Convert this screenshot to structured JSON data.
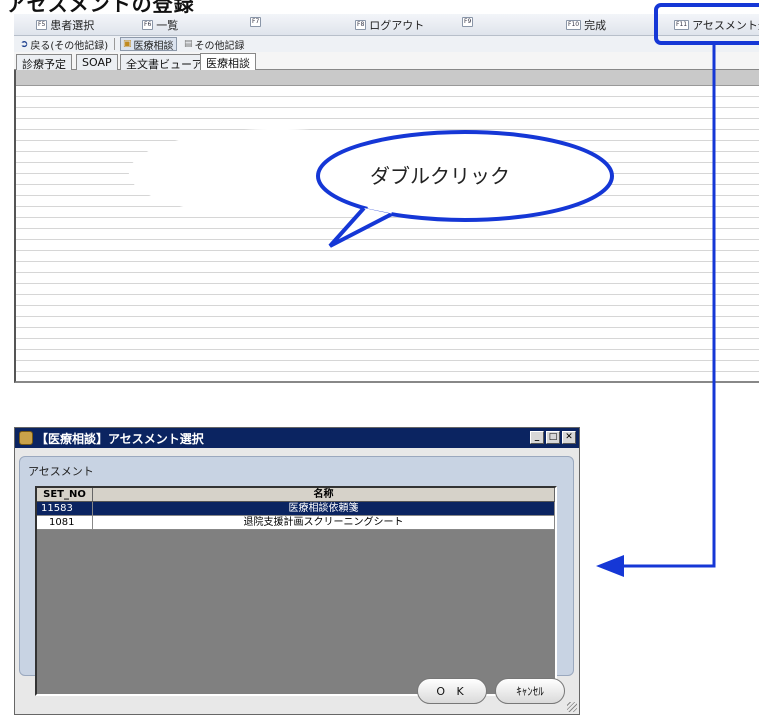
{
  "heading": "アセスメントの登録",
  "fkeys": [
    {
      "key": "F5",
      "label": "患者選択"
    },
    {
      "key": "F6",
      "label": "一覧"
    },
    {
      "key": "F7",
      "label": ""
    },
    {
      "key": "F8",
      "label": "ログアウト"
    },
    {
      "key": "F9",
      "label": ""
    },
    {
      "key": "F10",
      "label": "完成"
    },
    {
      "key": "F11",
      "label": "アセスメント登録"
    }
  ],
  "subbar": {
    "back": "戻る(その他記録)",
    "consult": "医療相談",
    "other": "その他記録"
  },
  "tabs": [
    "診療予定",
    "SOAP",
    "全文書ビューア",
    "医療相談"
  ],
  "callout": "ダブルクリック",
  "dialog": {
    "title": "【医療相談】アセスメント選択",
    "group_label": "アセスメント",
    "columns": [
      "SET_NO",
      "名称"
    ],
    "rows": [
      {
        "set_no": "11583",
        "name": "医療相談依頼箋"
      },
      {
        "set_no": "1081",
        "name": "退院支援計画スクリーニングシート"
      }
    ],
    "ok_label": "O K",
    "cancel_label": "ｷｬﾝｾﾙ"
  },
  "colors": {
    "highlight": "#1537d6",
    "title_bar": "#0b2461"
  }
}
